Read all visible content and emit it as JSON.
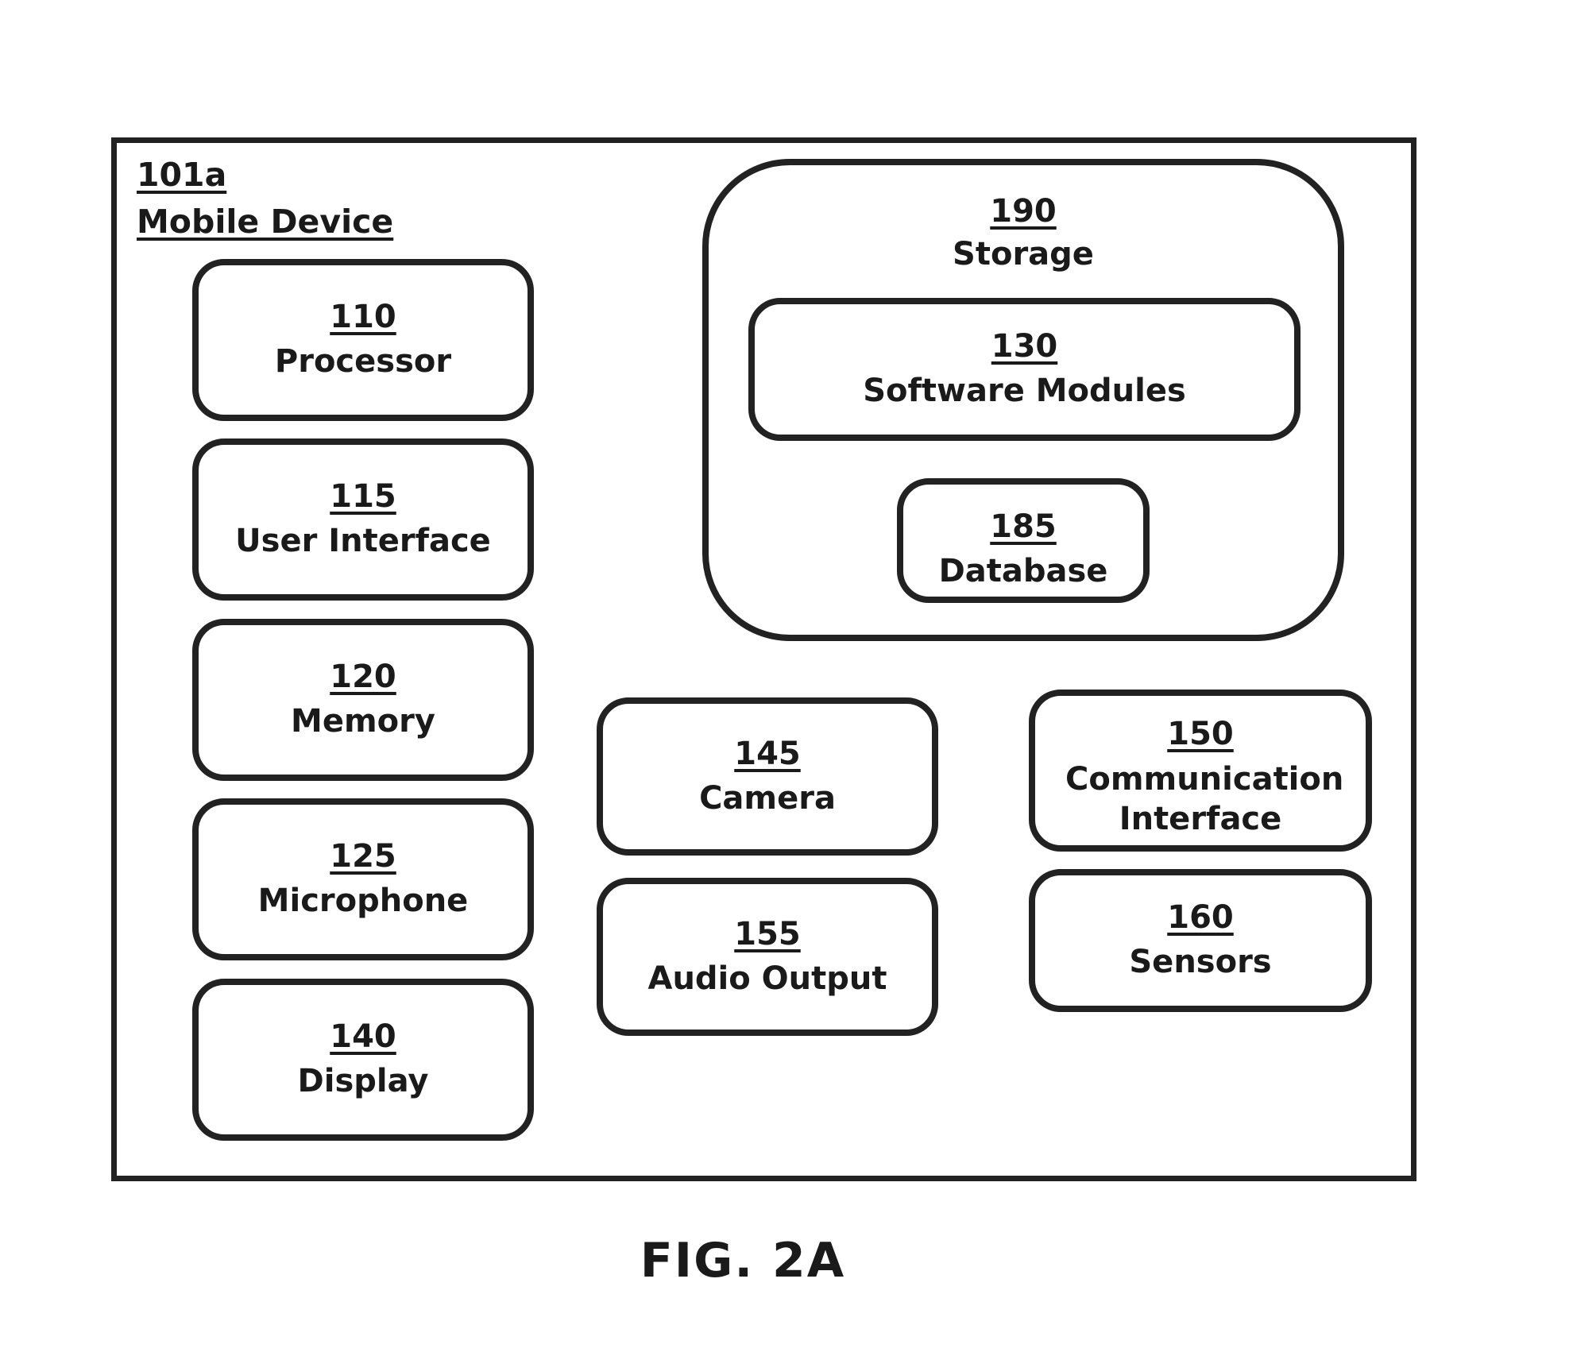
{
  "figure": {
    "caption": "FIG. 2A",
    "device": {
      "ref": "101a",
      "name": "Mobile Device"
    },
    "storage": {
      "ref": "190",
      "label": "Storage"
    },
    "components": {
      "processor": {
        "ref": "110",
        "label": "Processor"
      },
      "user_interface": {
        "ref": "115",
        "label": "User Interface"
      },
      "memory": {
        "ref": "120",
        "label": "Memory"
      },
      "microphone": {
        "ref": "125",
        "label": "Microphone"
      },
      "display": {
        "ref": "140",
        "label": "Display"
      },
      "software_modules": {
        "ref": "130",
        "label": "Software Modules"
      },
      "database": {
        "ref": "185",
        "label": "Database"
      },
      "camera": {
        "ref": "145",
        "label": "Camera"
      },
      "audio_output": {
        "ref": "155",
        "label": "Audio Output"
      },
      "communication_interface": {
        "ref": "150",
        "label": "Communication Interface"
      },
      "sensors": {
        "ref": "160",
        "label": "Sensors"
      }
    }
  }
}
